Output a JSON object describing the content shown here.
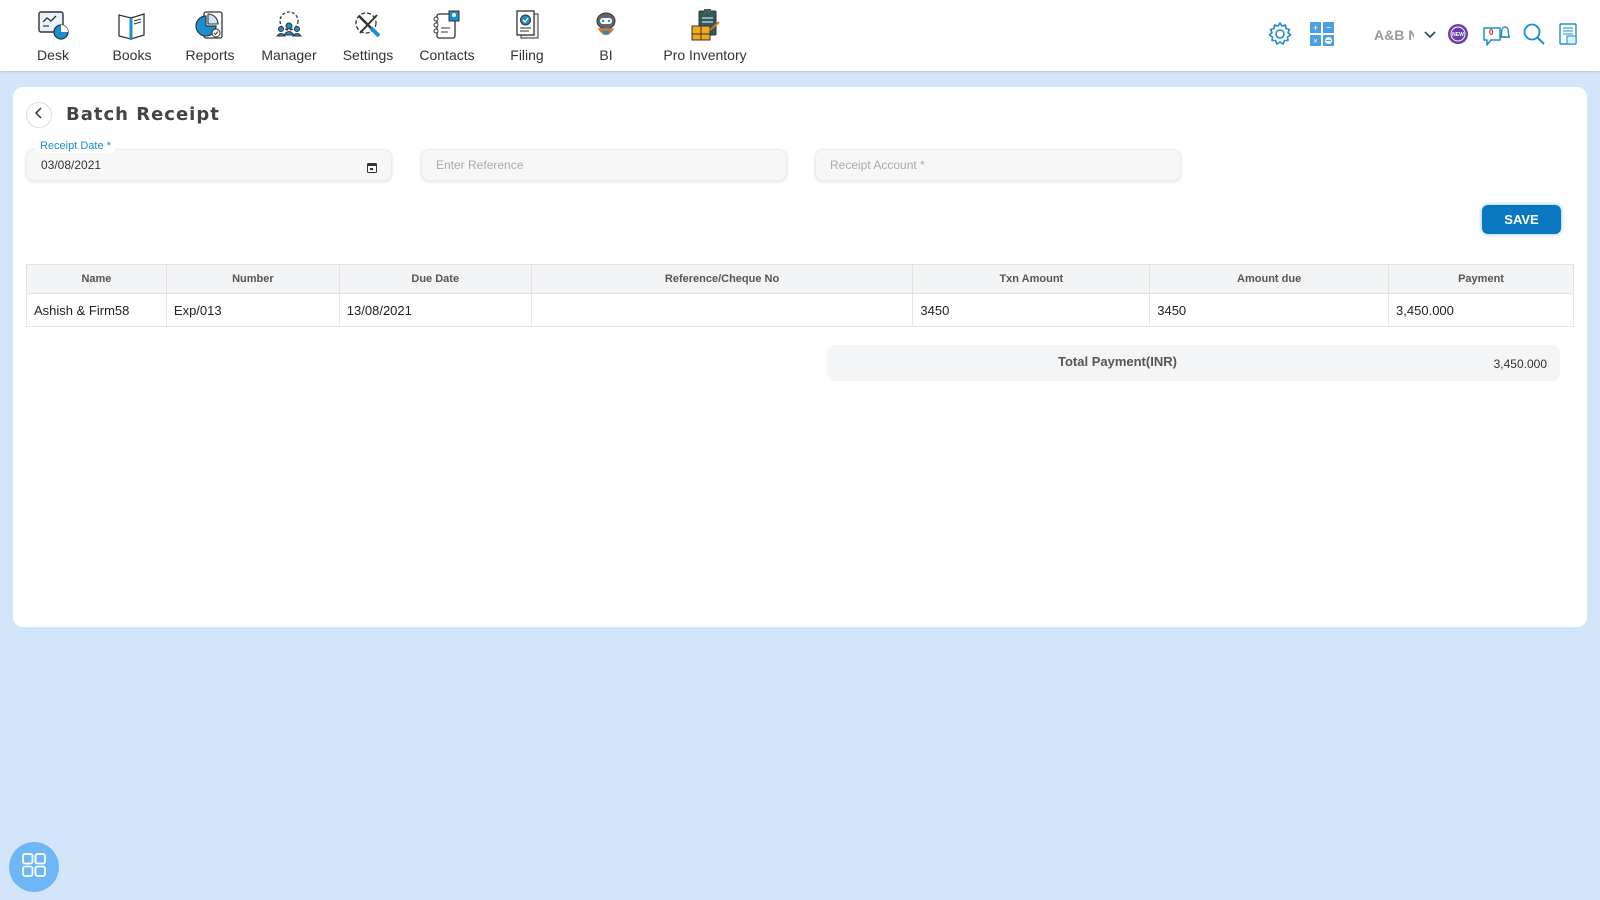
{
  "nav": {
    "items": [
      {
        "label": "Desk",
        "icon": "desk-icon"
      },
      {
        "label": "Books",
        "icon": "books-icon"
      },
      {
        "label": "Reports",
        "icon": "reports-icon"
      },
      {
        "label": "Manager",
        "icon": "manager-icon"
      },
      {
        "label": "Settings",
        "icon": "settings-tools-icon"
      },
      {
        "label": "Contacts",
        "icon": "contacts-icon"
      },
      {
        "label": "Filing",
        "icon": "filing-icon"
      },
      {
        "label": "BI",
        "icon": "bi-robot-icon"
      },
      {
        "label": "Pro Inventory",
        "icon": "pro-inventory-icon"
      }
    ]
  },
  "toolbar": {
    "company_name": "A&B N",
    "notification_count": "0",
    "new_badge": "NEW"
  },
  "page": {
    "title": "Batch Receipt",
    "receipt_date_label": "Receipt Date *",
    "receipt_date_value": "03/08/2021",
    "reference_placeholder": "Enter Reference",
    "receipt_account_placeholder": "Receipt Account *",
    "save_label": "SAVE"
  },
  "table": {
    "columns": [
      "Name",
      "Number",
      "Due Date",
      "Reference/Cheque No",
      "Txn Amount",
      "Amount due",
      "Payment"
    ],
    "rows": [
      {
        "name": "Ashish & Firm58",
        "number": "Exp/013",
        "due_date": "13/08/2021",
        "reference": "",
        "txn_amount": "3450",
        "amount_due": "3450",
        "payment": "3,450.000"
      }
    ]
  },
  "total": {
    "label": "Total Payment(INR)",
    "value": "3,450.000"
  },
  "colors": {
    "accent": "#0a78c0",
    "background": "#d3e5fb",
    "fab": "#6eb7f7"
  }
}
